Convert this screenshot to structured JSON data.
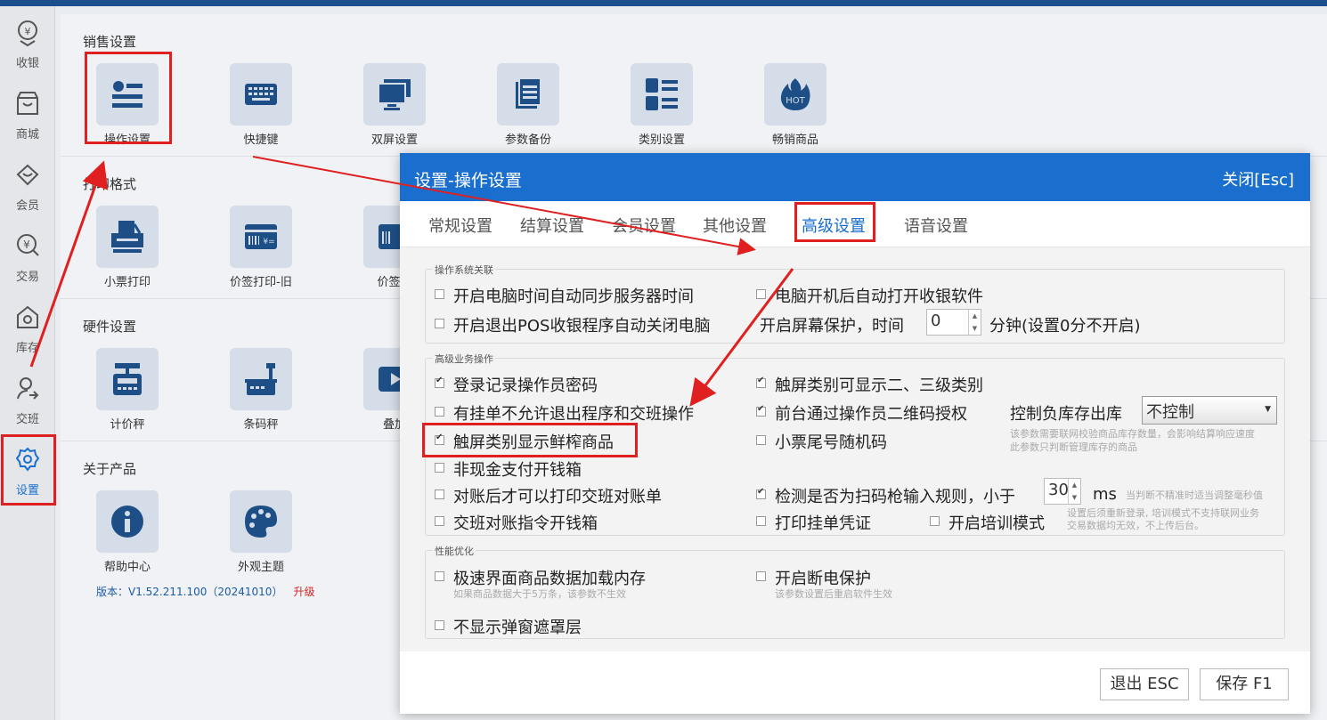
{
  "sidebar": {
    "items": [
      {
        "label": "收银",
        "icon": "cashier-icon"
      },
      {
        "label": "商城",
        "icon": "store-icon"
      },
      {
        "label": "会员",
        "icon": "member-icon"
      },
      {
        "label": "交易",
        "icon": "yen-icon"
      },
      {
        "label": "库存",
        "icon": "inventory-icon"
      },
      {
        "label": "交班",
        "icon": "shift-icon"
      },
      {
        "label": "设置",
        "icon": "gear-icon"
      }
    ]
  },
  "sections": [
    {
      "title": "销售设置",
      "tiles": [
        "操作设置",
        "快捷键",
        "双屏设置",
        "参数备份",
        "类别设置",
        "畅销商品"
      ]
    },
    {
      "title": "打印格式",
      "tiles": [
        "小票打印",
        "价签打印-旧",
        "价签打"
      ]
    },
    {
      "title": "硬件设置",
      "tiles": [
        "计价秤",
        "条码秤",
        "叠加"
      ]
    },
    {
      "title": "关于产品",
      "tiles": [
        "帮助中心",
        "外观主题"
      ]
    }
  ],
  "version": {
    "text": "版本：V1.52.211.100（20241010）",
    "upgrade": "升级"
  },
  "hot_badge": "HOT",
  "dialog": {
    "title": "设置-操作设置",
    "close": "关闭[Esc]",
    "tabs": [
      "常规设置",
      "结算设置",
      "会员设置",
      "其他设置",
      "高级设置",
      "语音设置"
    ],
    "active_tab": "高级设置",
    "group1": {
      "legend": "操作系统关联",
      "sync_time": "开启电脑时间自动同步服务器时间",
      "auto_start": "电脑开机后自动打开收银软件",
      "auto_shutdown": "开启退出POS收银程序自动关闭电脑",
      "screensaver_prefix": "开启屏幕保护，时间",
      "screensaver_value": "0",
      "screensaver_suffix": "分钟(设置0分不开启)"
    },
    "group2": {
      "legend": "高级业务操作",
      "record_pwd": "登录记录操作员密码",
      "touch_category": "触屏类别可显示二、三级类别",
      "no_exit_pending": "有挂单不允许退出程序和交班操作",
      "qr_auth": "前台通过操作员二维码授权",
      "neg_stock_label": "控制负库存出库",
      "neg_stock_value": "不控制",
      "neg_stock_hint1": "该参数需要联网校验商品库存数量，会影响结算响应速度",
      "neg_stock_hint2": "此参数只判断管理库存的商品",
      "fresh_products": "触屏类别显示鲜榨商品",
      "receipt_random": "小票尾号随机码",
      "non_cash_drawer": "非现金支付开钱箱",
      "print_after_check": "对账后才可以打印交班对账单",
      "scan_rule_prefix": "检测是否为扫码枪输入规则，小于",
      "scan_rule_value": "30",
      "scan_rule_unit": "ms",
      "scan_rule_hint": "当判断不精准时适当调整毫秒值",
      "shift_drawer": "交班对账指令开钱箱",
      "print_pending": "打印挂单凭证",
      "training_mode": "开启培训模式",
      "training_hint1": "设置后须重新登录, 培训模式不支持联网业务",
      "training_hint2": "交易数据均无效，不上传后台。"
    },
    "group3": {
      "legend": "性能优化",
      "fast_load": "极速界面商品数据加载内存",
      "fast_load_hint": "如果商品数据大于5万条，该参数不生效",
      "power_protect": "开启断电保护",
      "power_protect_hint": "该参数设置后重启软件生效",
      "no_mask": "不显示弹窗遮罩层"
    },
    "buttons": {
      "exit": "退出 ESC",
      "save": "保存 F1"
    }
  },
  "colors": {
    "accent": "#1a6fce",
    "annotation": "#e02020",
    "tile_bg": "#d5dde8",
    "icon": "#1d4f86"
  }
}
